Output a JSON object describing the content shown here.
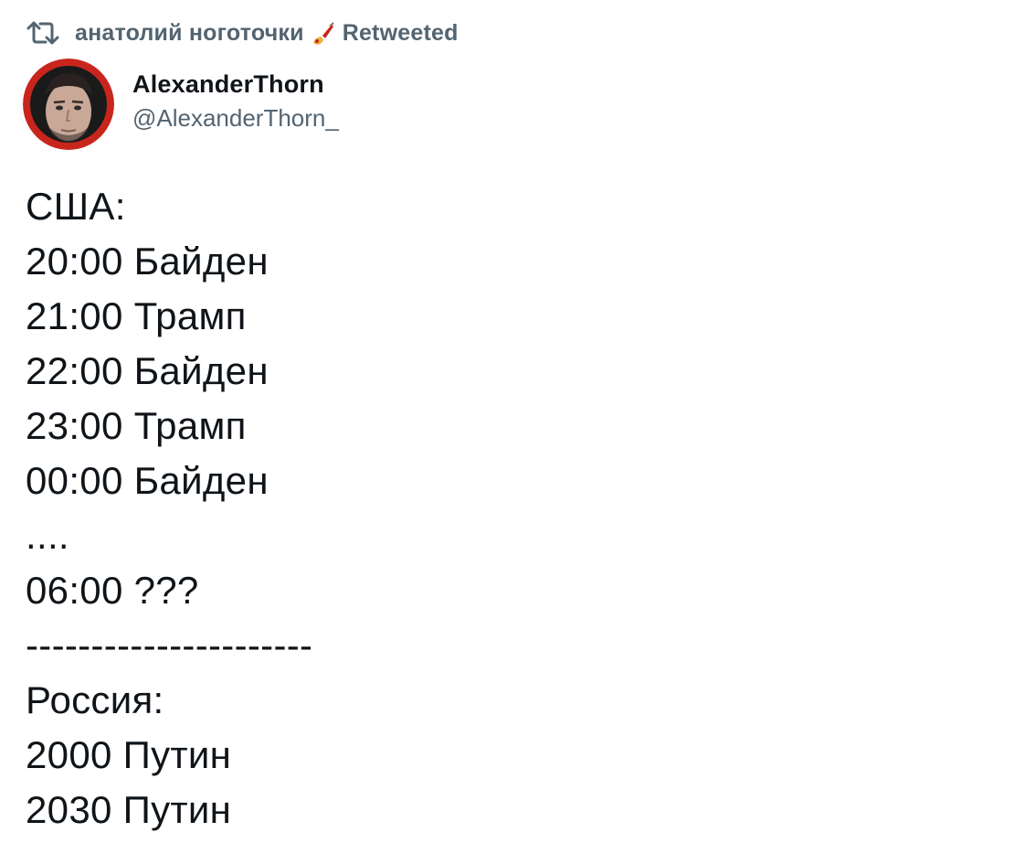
{
  "retweet": {
    "retweeter_name": "анатолий ноготочки",
    "retweeter_emoji": "nail-polish-icon",
    "action_label": "Retweeted"
  },
  "author": {
    "display_name": "AlexanderThorn",
    "handle": "@AlexanderThorn_",
    "avatar": "profile-photo"
  },
  "tweet": {
    "lines": [
      "США:",
      "20:00 Байден",
      "21:00 Трамп",
      "22:00 Байден",
      "23:00 Трамп",
      "00:00 Байден",
      "....",
      "06:00 ???",
      "----------------------",
      "Россия:",
      "2000 Путин",
      "2030 Путин"
    ]
  },
  "colors": {
    "text_primary": "#0f1419",
    "text_secondary": "#536471",
    "avatar_ring": "#c8261d"
  }
}
